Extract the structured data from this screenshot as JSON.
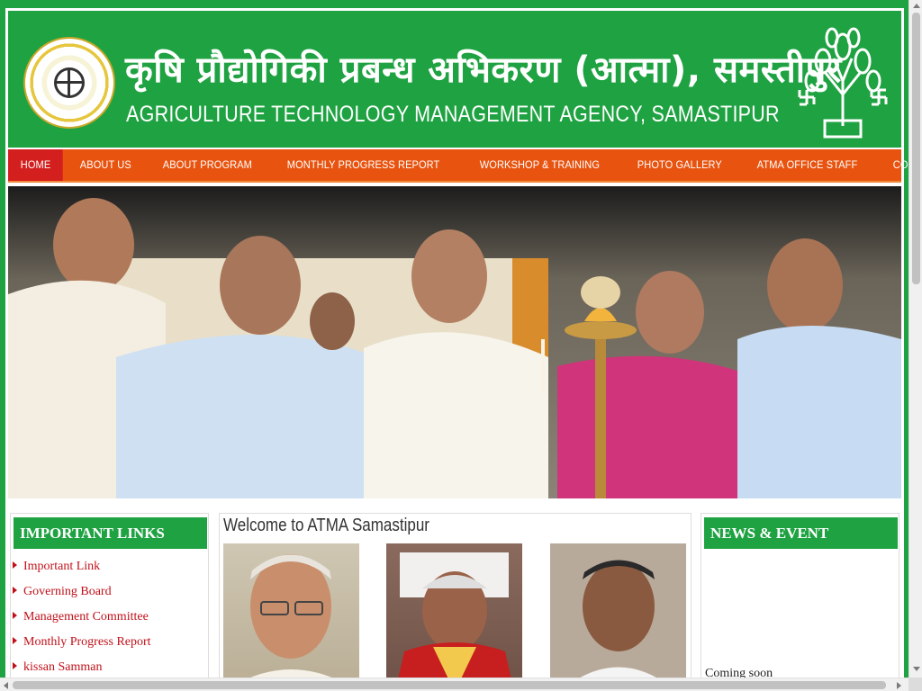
{
  "header": {
    "title_hindi": "कृषि प्रौद्योगिकी प्रबन्ध अभिकरण (आत्मा), समस्तीपुर",
    "title_english": "AGRICULTURE TECHNOLOGY MANAGEMENT AGENCY, SAMASTIPUR",
    "logo_left_icon": "government-seal-emblem",
    "logo_right_icon": "bodhi-tree-emblem",
    "brand_green": "#1fa242"
  },
  "nav": {
    "accent": "#e85410",
    "active_color": "#d41f1f",
    "items": [
      {
        "label": "HOME",
        "active": true
      },
      {
        "label": "ABOUT US"
      },
      {
        "label": "ABOUT PROGRAM"
      },
      {
        "label": "MONTHLY PROGRESS REPORT"
      },
      {
        "label": "WORKSHOP & TRAINING"
      },
      {
        "label": "PHOTO GALLERY"
      },
      {
        "label": "ATMA OFFICE STAFF"
      },
      {
        "label": "CONTACT US"
      }
    ]
  },
  "banner": {
    "icon": "lamp-lighting-ceremony-photo"
  },
  "important_links": {
    "heading": "IMPORTANT LINKS",
    "items": [
      "Important Link",
      "Governing Board",
      "Management Committee",
      "Monthly Progress Report",
      "kissan Samman"
    ]
  },
  "welcome": {
    "heading": "Welcome to ATMA Samastipur",
    "portraits": [
      "portrait-photo",
      "portrait-photo",
      "portrait-photo"
    ]
  },
  "news": {
    "heading": "NEWS & EVENT",
    "text": "Coming soon"
  }
}
